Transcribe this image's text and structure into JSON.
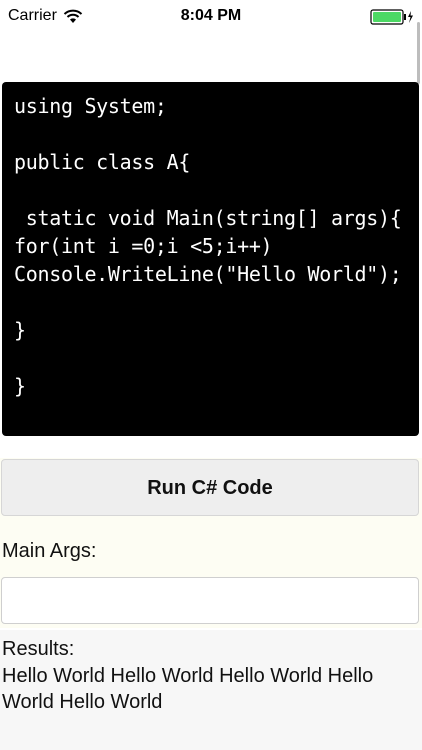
{
  "status_bar": {
    "carrier": "Carrier",
    "time": "8:04 PM"
  },
  "editor": {
    "code": "using System;\n\npublic class A{\n\n static void Main(string[] args){\nfor(int i =0;i <5;i++)\nConsole.WriteLine(\"Hello World\");\n\n}\n\n}"
  },
  "run_button": {
    "label": "Run C# Code"
  },
  "args": {
    "label": "Main Args:",
    "value": ""
  },
  "results": {
    "label": "Results:",
    "text": "Hello World Hello World Hello World Hello World Hello World"
  },
  "colors": {
    "editor_bg": "#000000",
    "button_bg": "#eeeeee",
    "battery": "#4cd964"
  },
  "icons": {
    "wifi": "wifi-icon",
    "battery": "battery-icon"
  }
}
